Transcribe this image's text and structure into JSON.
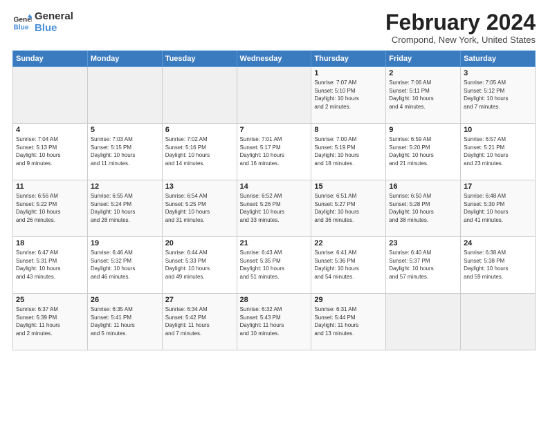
{
  "logo": {
    "line1": "General",
    "line2": "Blue"
  },
  "header": {
    "month": "February 2024",
    "location": "Crompond, New York, United States"
  },
  "weekdays": [
    "Sunday",
    "Monday",
    "Tuesday",
    "Wednesday",
    "Thursday",
    "Friday",
    "Saturday"
  ],
  "weeks": [
    [
      {
        "day": "",
        "info": ""
      },
      {
        "day": "",
        "info": ""
      },
      {
        "day": "",
        "info": ""
      },
      {
        "day": "",
        "info": ""
      },
      {
        "day": "1",
        "info": "Sunrise: 7:07 AM\nSunset: 5:10 PM\nDaylight: 10 hours\nand 2 minutes."
      },
      {
        "day": "2",
        "info": "Sunrise: 7:06 AM\nSunset: 5:11 PM\nDaylight: 10 hours\nand 4 minutes."
      },
      {
        "day": "3",
        "info": "Sunrise: 7:05 AM\nSunset: 5:12 PM\nDaylight: 10 hours\nand 7 minutes."
      }
    ],
    [
      {
        "day": "4",
        "info": "Sunrise: 7:04 AM\nSunset: 5:13 PM\nDaylight: 10 hours\nand 9 minutes."
      },
      {
        "day": "5",
        "info": "Sunrise: 7:03 AM\nSunset: 5:15 PM\nDaylight: 10 hours\nand 11 minutes."
      },
      {
        "day": "6",
        "info": "Sunrise: 7:02 AM\nSunset: 5:16 PM\nDaylight: 10 hours\nand 14 minutes."
      },
      {
        "day": "7",
        "info": "Sunrise: 7:01 AM\nSunset: 5:17 PM\nDaylight: 10 hours\nand 16 minutes."
      },
      {
        "day": "8",
        "info": "Sunrise: 7:00 AM\nSunset: 5:19 PM\nDaylight: 10 hours\nand 18 minutes."
      },
      {
        "day": "9",
        "info": "Sunrise: 6:59 AM\nSunset: 5:20 PM\nDaylight: 10 hours\nand 21 minutes."
      },
      {
        "day": "10",
        "info": "Sunrise: 6:57 AM\nSunset: 5:21 PM\nDaylight: 10 hours\nand 23 minutes."
      }
    ],
    [
      {
        "day": "11",
        "info": "Sunrise: 6:56 AM\nSunset: 5:22 PM\nDaylight: 10 hours\nand 26 minutes."
      },
      {
        "day": "12",
        "info": "Sunrise: 6:55 AM\nSunset: 5:24 PM\nDaylight: 10 hours\nand 28 minutes."
      },
      {
        "day": "13",
        "info": "Sunrise: 6:54 AM\nSunset: 5:25 PM\nDaylight: 10 hours\nand 31 minutes."
      },
      {
        "day": "14",
        "info": "Sunrise: 6:52 AM\nSunset: 5:26 PM\nDaylight: 10 hours\nand 33 minutes."
      },
      {
        "day": "15",
        "info": "Sunrise: 6:51 AM\nSunset: 5:27 PM\nDaylight: 10 hours\nand 36 minutes."
      },
      {
        "day": "16",
        "info": "Sunrise: 6:50 AM\nSunset: 5:28 PM\nDaylight: 10 hours\nand 38 minutes."
      },
      {
        "day": "17",
        "info": "Sunrise: 6:48 AM\nSunset: 5:30 PM\nDaylight: 10 hours\nand 41 minutes."
      }
    ],
    [
      {
        "day": "18",
        "info": "Sunrise: 6:47 AM\nSunset: 5:31 PM\nDaylight: 10 hours\nand 43 minutes."
      },
      {
        "day": "19",
        "info": "Sunrise: 6:46 AM\nSunset: 5:32 PM\nDaylight: 10 hours\nand 46 minutes."
      },
      {
        "day": "20",
        "info": "Sunrise: 6:44 AM\nSunset: 5:33 PM\nDaylight: 10 hours\nand 49 minutes."
      },
      {
        "day": "21",
        "info": "Sunrise: 6:43 AM\nSunset: 5:35 PM\nDaylight: 10 hours\nand 51 minutes."
      },
      {
        "day": "22",
        "info": "Sunrise: 6:41 AM\nSunset: 5:36 PM\nDaylight: 10 hours\nand 54 minutes."
      },
      {
        "day": "23",
        "info": "Sunrise: 6:40 AM\nSunset: 5:37 PM\nDaylight: 10 hours\nand 57 minutes."
      },
      {
        "day": "24",
        "info": "Sunrise: 6:38 AM\nSunset: 5:38 PM\nDaylight: 10 hours\nand 59 minutes."
      }
    ],
    [
      {
        "day": "25",
        "info": "Sunrise: 6:37 AM\nSunset: 5:39 PM\nDaylight: 11 hours\nand 2 minutes."
      },
      {
        "day": "26",
        "info": "Sunrise: 6:35 AM\nSunset: 5:41 PM\nDaylight: 11 hours\nand 5 minutes."
      },
      {
        "day": "27",
        "info": "Sunrise: 6:34 AM\nSunset: 5:42 PM\nDaylight: 11 hours\nand 7 minutes."
      },
      {
        "day": "28",
        "info": "Sunrise: 6:32 AM\nSunset: 5:43 PM\nDaylight: 11 hours\nand 10 minutes."
      },
      {
        "day": "29",
        "info": "Sunrise: 6:31 AM\nSunset: 5:44 PM\nDaylight: 11 hours\nand 13 minutes."
      },
      {
        "day": "",
        "info": ""
      },
      {
        "day": "",
        "info": ""
      }
    ]
  ]
}
